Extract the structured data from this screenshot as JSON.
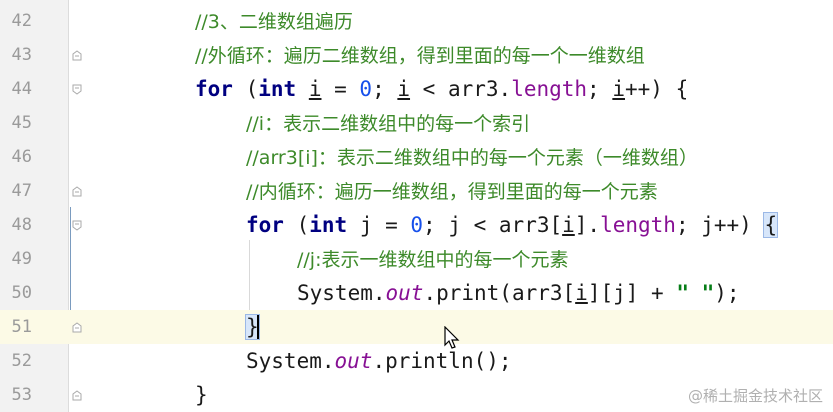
{
  "editor": {
    "lines": [
      {
        "num": "42",
        "comment": "//3、二维数组遍历"
      },
      {
        "num": "43",
        "comment": "//外循环：遍历二维数组，得到里面的每一个一维数组"
      },
      {
        "num": "44",
        "tokens": [
          "for",
          " (",
          "int",
          " ",
          "i",
          " = ",
          "0",
          "; ",
          "i",
          " < arr3.",
          "length",
          "; ",
          "i",
          "++) {"
        ]
      },
      {
        "num": "45",
        "comment": "//i：表示二维数组中的每一个索引"
      },
      {
        "num": "46",
        "comment": "//arr3[i]：表示二维数组中的每一个元素（一维数组）"
      },
      {
        "num": "47",
        "comment": "//内循环：遍历一维数组，得到里面的每一个元素"
      },
      {
        "num": "48",
        "tokens": [
          "for",
          " (",
          "int",
          " j = ",
          "0",
          "; j < arr3[",
          "i",
          "].",
          "length",
          "; j++) ",
          "{"
        ]
      },
      {
        "num": "49",
        "comment": "//j:表示一维数组中的每一个元素"
      },
      {
        "num": "50",
        "tokens": [
          "System.",
          "out",
          ".print(arr3[",
          "i",
          "][j] + ",
          "\" \"",
          ");"
        ]
      },
      {
        "num": "51",
        "tokens": [
          "}"
        ]
      },
      {
        "num": "52",
        "tokens": [
          "System.",
          "out",
          ".println();"
        ]
      },
      {
        "num": "53",
        "tokens": [
          "}"
        ]
      }
    ]
  },
  "watermark": "@稀土掘金技术社区"
}
